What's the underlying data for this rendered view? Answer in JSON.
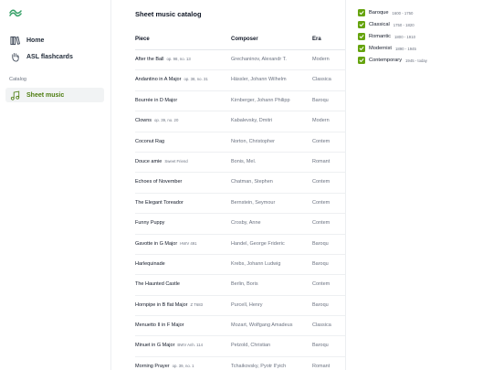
{
  "sidebar": {
    "logo_icon": "tailwind-wave-logo",
    "items": [
      {
        "label": "Home",
        "icon": "library-icon"
      },
      {
        "label": "ASL flashcards",
        "icon": "hand-icon"
      },
      {
        "label": "Sheet music",
        "icon": "music-note-icon"
      }
    ],
    "section_label": "Catalog",
    "active_color": "#4d7c0f"
  },
  "main": {
    "title": "Sheet music catalog",
    "columns": [
      "Piece",
      "Composer",
      "Era"
    ],
    "rows": [
      {
        "piece": "After the Ball",
        "opus": "op. 98, no. 13",
        "composer": "Grechaninov, Alexandr T.",
        "era": "Modern"
      },
      {
        "piece": "Andantino in A Major",
        "opus": "op. 38, no. 31",
        "composer": "Hässler, Johann Wilhelm",
        "era": "Classica"
      },
      {
        "piece": "Bourrée in D Major",
        "opus": "",
        "composer": "Kirnberger, Johann Philipp",
        "era": "Baroqu"
      },
      {
        "piece": "Clowns",
        "opus": "op. 39, no. 20",
        "composer": "Kabalevsky, Dmitri",
        "era": "Modern"
      },
      {
        "piece": "Coconut Rag",
        "opus": "",
        "composer": "Norton, Christopher",
        "era": "Contem"
      },
      {
        "piece": "Douce amie",
        "opus": "Sweet Friend",
        "composer": "Bonis, Mel.",
        "era": "Romant"
      },
      {
        "piece": "Echoes of November",
        "opus": "",
        "composer": "Chatman, Stephen",
        "era": "Contem"
      },
      {
        "piece": "The Elegant Toreador",
        "opus": "",
        "composer": "Bernstein, Seymour",
        "era": "Contem"
      },
      {
        "piece": "Funny Puppy",
        "opus": "",
        "composer": "Crosby, Anne",
        "era": "Contem"
      },
      {
        "piece": "Gavotte in G Major",
        "opus": "HWV 491",
        "composer": "Handel, George Frideric",
        "era": "Baroqu"
      },
      {
        "piece": "Harlequinade",
        "opus": "",
        "composer": "Krebs, Johann Ludwig",
        "era": "Baroqu"
      },
      {
        "piece": "The Haunted Castle",
        "opus": "",
        "composer": "Berlin, Boris",
        "era": "Contem"
      },
      {
        "piece": "Hornpipe in B flat Major",
        "opus": "Z T683",
        "composer": "Purcell, Henry",
        "era": "Baroqu"
      },
      {
        "piece": "Menuetto II in F Major",
        "opus": "",
        "composer": "Mozart, Wolfgang Amadeus",
        "era": "Classica"
      },
      {
        "piece": "Minuet in G Major",
        "opus": "BWV Anh. 114",
        "composer": "Petzold, Christian",
        "era": "Baroqu"
      },
      {
        "piece": "Morning Prayer",
        "opus": "op. 39, no. 1",
        "composer": "Tchaikovsky, Pyotr Il'yich",
        "era": "Romant"
      }
    ]
  },
  "filters": {
    "check_color": "#65a30d",
    "items": [
      {
        "name": "Baroque",
        "years": "1600 - 1750",
        "checked": true
      },
      {
        "name": "Classical",
        "years": "1750 - 1820",
        "checked": true
      },
      {
        "name": "Romantic",
        "years": "1800 - 1910",
        "checked": true
      },
      {
        "name": "Modernist",
        "years": "1890 - 1945",
        "checked": true
      },
      {
        "name": "Contemporary",
        "years": "1945 - today",
        "checked": true
      }
    ]
  }
}
